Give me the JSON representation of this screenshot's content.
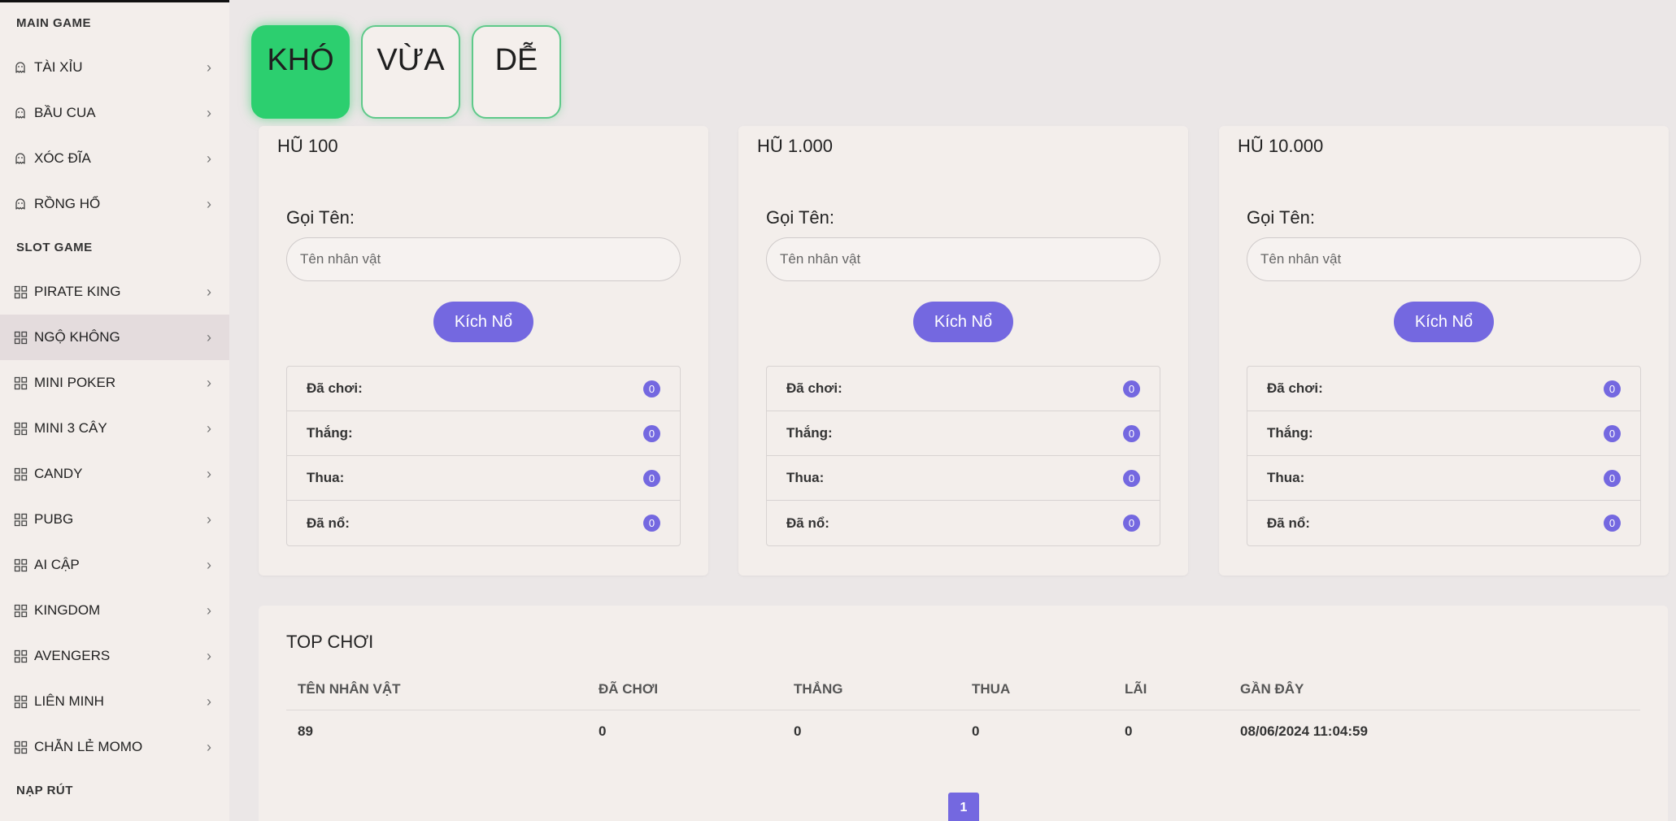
{
  "sidebar": {
    "sections": [
      {
        "title": "MAIN GAME"
      },
      {
        "title": "SLOT GAME"
      },
      {
        "title": "NẠP RÚT"
      }
    ],
    "main_items": [
      {
        "label": "TÀI XỈU",
        "icon": "ghost-icon"
      },
      {
        "label": "BẦU CUA",
        "icon": "ghost-icon"
      },
      {
        "label": "XÓC ĐĨA",
        "icon": "ghost-icon"
      },
      {
        "label": "RỒNG HỔ",
        "icon": "ghost-icon"
      }
    ],
    "slot_items": [
      {
        "label": "PIRATE KING",
        "icon": "grid-icon"
      },
      {
        "label": "NGỘ KHÔNG",
        "icon": "grid-icon",
        "active": true
      },
      {
        "label": "MINI POKER",
        "icon": "grid-icon"
      },
      {
        "label": "MINI 3 CÂY",
        "icon": "grid-icon"
      },
      {
        "label": "CANDY",
        "icon": "grid-icon"
      },
      {
        "label": "PUBG",
        "icon": "grid-icon"
      },
      {
        "label": "AI CẬP",
        "icon": "grid-icon"
      },
      {
        "label": "KINGDOM",
        "icon": "grid-icon"
      },
      {
        "label": "AVENGERS",
        "icon": "grid-icon"
      },
      {
        "label": "LIÊN MINH",
        "icon": "grid-icon"
      },
      {
        "label": "CHẴN LẺ MOMO",
        "icon": "grid-icon"
      }
    ]
  },
  "tabs": [
    {
      "label": "KHÓ",
      "active": true
    },
    {
      "label": "VỪA"
    },
    {
      "label": "DỄ"
    }
  ],
  "cards": [
    {
      "title": "HŨ 100",
      "name_label": "Gọi Tên:",
      "placeholder": "Tên nhân vật",
      "button": "Kích Nổ",
      "stats": [
        {
          "label": "Đã chơi:",
          "value": "0"
        },
        {
          "label": "Thắng:",
          "value": "0"
        },
        {
          "label": "Thua:",
          "value": "0"
        },
        {
          "label": "Đã nổ:",
          "value": "0"
        }
      ]
    },
    {
      "title": "HŨ 1.000",
      "name_label": "Gọi Tên:",
      "placeholder": "Tên nhân vật",
      "button": "Kích Nổ",
      "stats": [
        {
          "label": "Đã chơi:",
          "value": "0"
        },
        {
          "label": "Thắng:",
          "value": "0"
        },
        {
          "label": "Thua:",
          "value": "0"
        },
        {
          "label": "Đã nổ:",
          "value": "0"
        }
      ]
    },
    {
      "title": "HŨ 10.000",
      "name_label": "Gọi Tên:",
      "placeholder": "Tên nhân vật",
      "button": "Kích Nổ",
      "stats": [
        {
          "label": "Đã chơi:",
          "value": "0"
        },
        {
          "label": "Thắng:",
          "value": "0"
        },
        {
          "label": "Thua:",
          "value": "0"
        },
        {
          "label": "Đã nổ:",
          "value": "0"
        }
      ]
    }
  ],
  "top": {
    "title": "TOP CHƠI",
    "columns": [
      "TÊN NHÂN VẬT",
      "ĐÃ CHƠI",
      "THẮNG",
      "THUA",
      "LÃI",
      "GẦN ĐÂY"
    ],
    "rows": [
      [
        "89",
        "0",
        "0",
        "0",
        "0",
        "08/06/2024 11:04:59"
      ]
    ],
    "page": "1"
  },
  "colors": {
    "accent": "#7468e0",
    "active_tab": "#2ccf6f",
    "tab_border": "#5fc98a"
  }
}
